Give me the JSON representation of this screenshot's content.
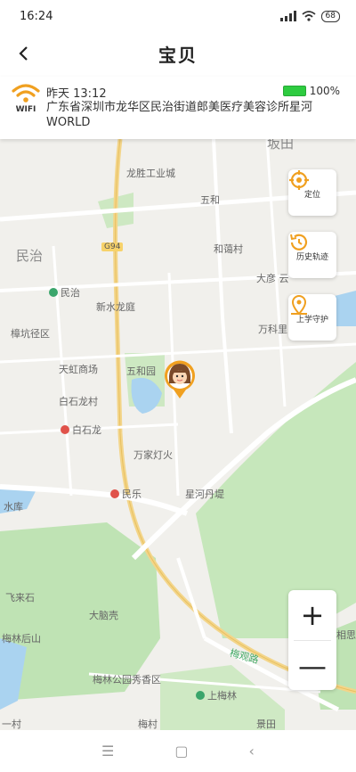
{
  "status_bar": {
    "time": "16:24",
    "battery": "68"
  },
  "header": {
    "back_icon": "chevron-left-icon",
    "title": "宝贝"
  },
  "info": {
    "wifi_label": "WIFI",
    "time": "昨天 13:12",
    "battery_percent": "100%",
    "address": "广东省深圳市龙华区民治街道郎美医疗美容诊所星河WORLD"
  },
  "map": {
    "labels": {
      "bantian": "坂田",
      "minzhi_big": "民治",
      "longsheng": "龙胜工业城",
      "wuhe": "五和",
      "hefengcun": "和蔼村",
      "dafen": "大彦 云",
      "road_g94": "G94",
      "minzhi_station": "民治",
      "xinshuilongyi": "新水龙庭",
      "zhangkengjingqu": "樟坑径区",
      "tianhong": "天虹商场",
      "wuheyuan": "五和园",
      "wankexu": "万科里",
      "baishilongcun": "白石龙村",
      "baishilong": "白石龙",
      "wanjiadenghuo": "万家灯火",
      "minle": "民乐",
      "xingheda": "星河丹堤",
      "shuiku": "水库",
      "feilaishi": "飞来石",
      "danaoke": "大脑壳",
      "meilinhoushan": "梅林后山",
      "meilinroad": "梅观路",
      "meilinpark": "梅林公园秀香区",
      "shangmeilin": "上梅林",
      "meicun": "梅村",
      "xiangmi": "相思",
      "yicun": "一村",
      "jingtian": "景田"
    }
  },
  "side_buttons": {
    "locate": "定位",
    "history": "历史轨迹",
    "school_guard": "上学守护"
  },
  "zoom": {
    "plus": "+",
    "minus": "—"
  },
  "bottom_nav": {
    "menu": "☰",
    "home": "▢",
    "back": "‹"
  },
  "colors": {
    "accent": "#f0a020",
    "battery": "#2ecc40",
    "water": "#aad3f0",
    "park": "#bfe3b4"
  }
}
